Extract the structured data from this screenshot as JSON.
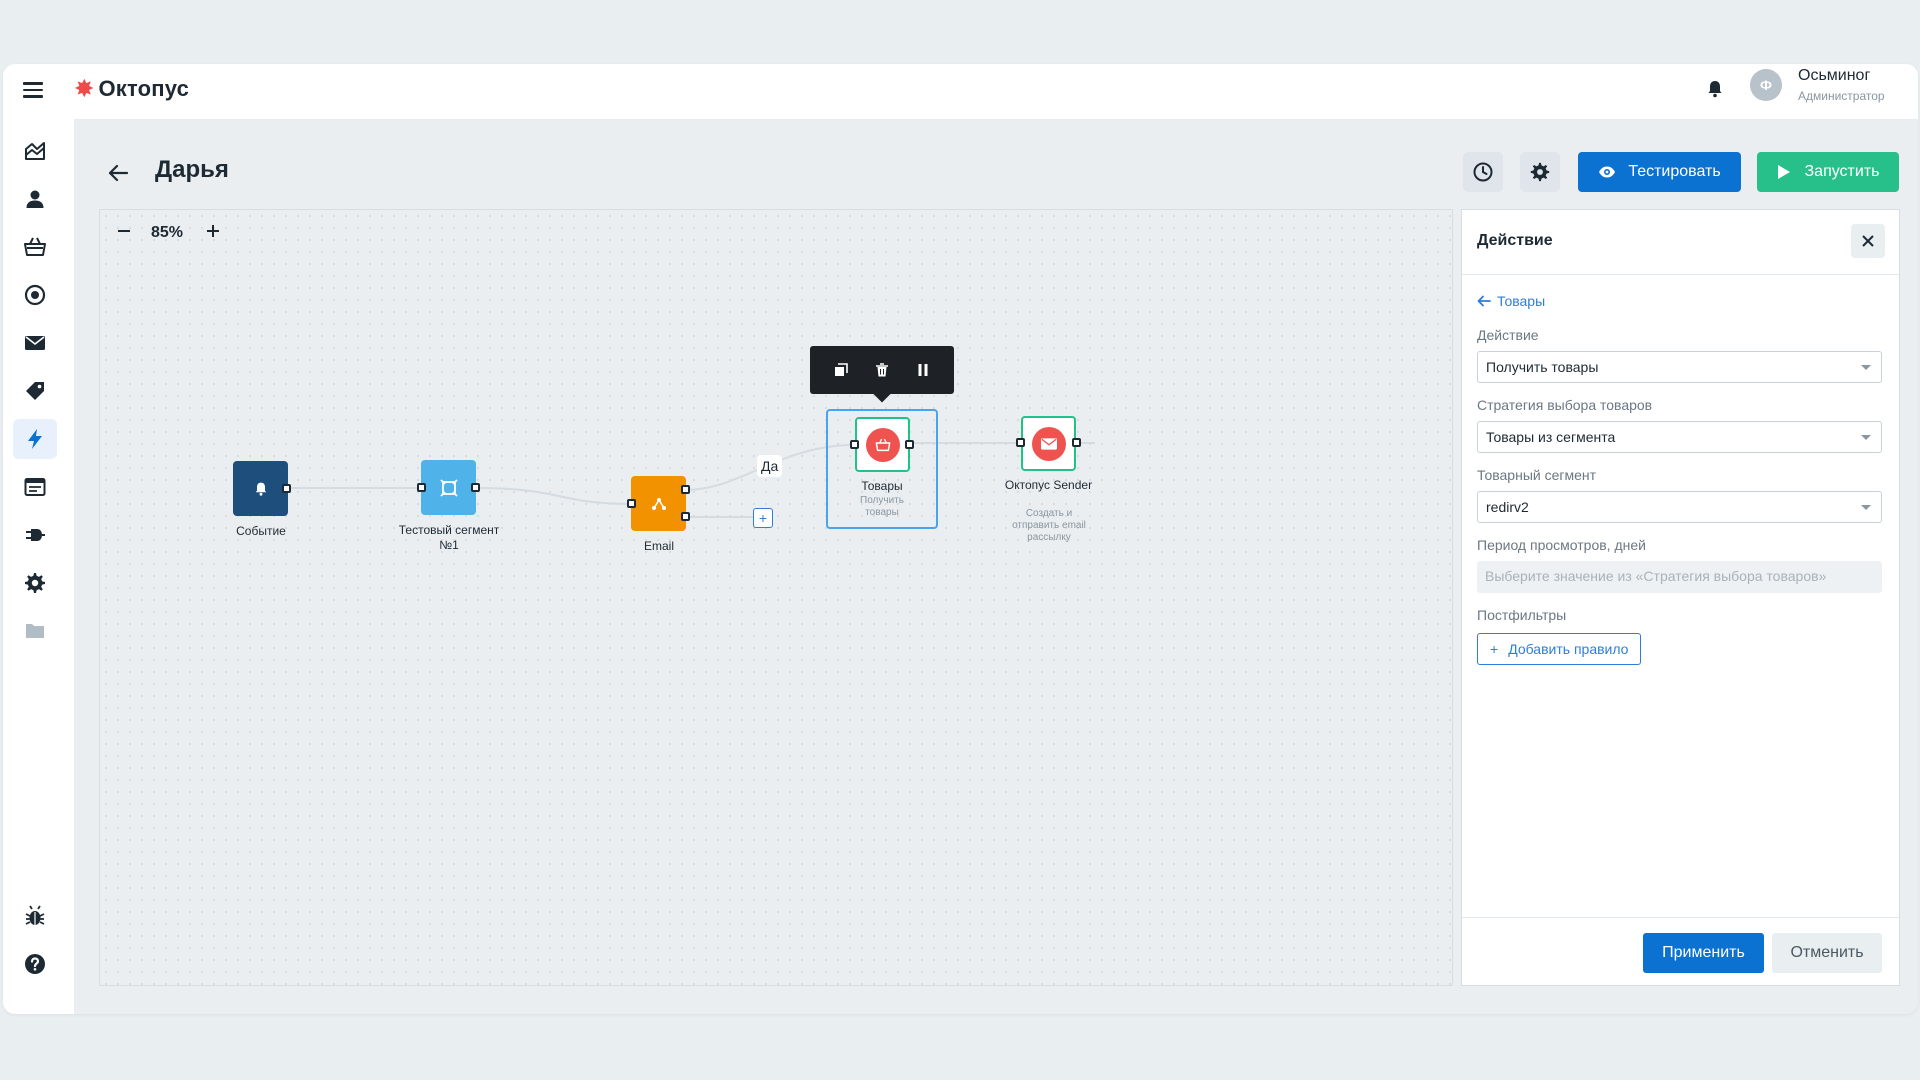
{
  "app": {
    "logo_text": "Октопус"
  },
  "user": {
    "name": "Осьминог",
    "role": "Администратор",
    "avatar_initial": "Ф"
  },
  "sidebar": {
    "items": [
      {
        "icon": "chart-icon"
      },
      {
        "icon": "user-icon"
      },
      {
        "icon": "basket-icon"
      },
      {
        "icon": "target-icon"
      },
      {
        "icon": "mail-icon"
      },
      {
        "icon": "tag-icon"
      },
      {
        "icon": "lightning-icon",
        "active": true
      },
      {
        "icon": "window-icon"
      },
      {
        "icon": "plug-icon"
      },
      {
        "icon": "gear-icon"
      },
      {
        "icon": "folder-icon"
      },
      {
        "icon": "bug-icon"
      },
      {
        "icon": "help-icon"
      }
    ]
  },
  "header": {
    "title": "Дарья",
    "test_label": "Тестировать",
    "run_label": "Запустить"
  },
  "canvas": {
    "zoom": "85%",
    "yes_label": "Да",
    "nodes": {
      "event": {
        "label": "Событие",
        "color": "#1d4e7c"
      },
      "segment": {
        "label": "Тестовый сегмент №1",
        "color": "#4fb3ea"
      },
      "email": {
        "label": "Email",
        "color": "#f39200"
      },
      "products": {
        "label": "Товары",
        "sub": "Получить товары",
        "color": "#ef5350"
      },
      "sender": {
        "label": "Октопус Sender",
        "sub": "Создать и отправить email рассылку",
        "color": "#ef5350"
      }
    }
  },
  "panel": {
    "title": "Действие",
    "back_label": "Товары",
    "action_label": "Действие",
    "action_value": "Получить товары",
    "strategy_label": "Стратегия выбора товаров",
    "strategy_value": "Товары из сегмента",
    "segment_label": "Товарный сегмент",
    "segment_value": "redirv2",
    "period_label": "Период просмотров, дней",
    "period_placeholder": "Выберите значение из «Стратегия выбора товаров»",
    "postfilters_label": "Постфильтры",
    "add_rule_label": "Добавить правило",
    "apply_label": "Применить",
    "cancel_label": "Отменить"
  }
}
